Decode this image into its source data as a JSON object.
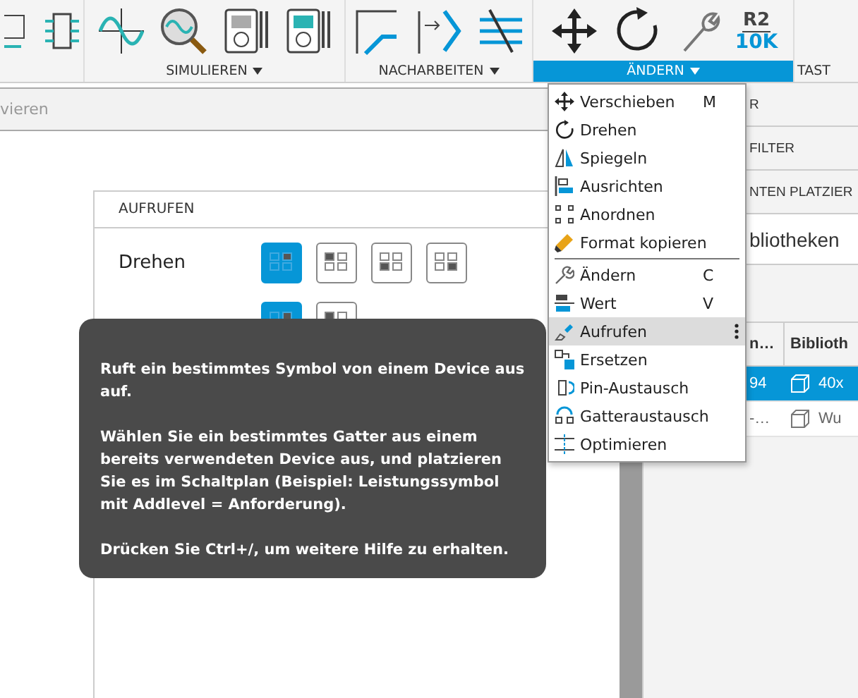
{
  "toolbar": {
    "groups": [
      {
        "label": "SIMULIEREN",
        "selected": false
      },
      {
        "label": "NACHARBEITEN",
        "selected": false
      },
      {
        "label": "ÄNDERN",
        "selected": true,
        "value_icon": {
          "top": "R2",
          "bottom": "10K"
        }
      },
      {
        "label": "TAST",
        "selected": false
      }
    ]
  },
  "search": {
    "placeholder": "vieren"
  },
  "command_panel": {
    "title": "AUFRUFEN",
    "rows": [
      {
        "label": "Drehen",
        "options": [
          {
            "selected": true
          },
          {
            "selected": false
          },
          {
            "selected": false
          },
          {
            "selected": false
          }
        ]
      },
      {
        "options": [
          {
            "selected": true
          },
          {
            "selected": false
          }
        ]
      }
    ]
  },
  "tooltip": {
    "paragraphs": [
      "Ruft ein bestimmtes Symbol von einem Device aus auf.",
      "Wählen Sie ein bestimmtes Gatter aus einem bereits verwendeten Device aus, und platzieren Sie es im Schaltplan (Beispiel: Leistungssymbol mit Addlevel = Anforderung).",
      "Drücken Sie Ctrl+/, um weitere Hilfe zu erhalten."
    ]
  },
  "menu": {
    "groups": [
      [
        {
          "label": "Verschieben",
          "shortcut": "M",
          "selected": false
        },
        {
          "label": "Drehen",
          "selected": false
        },
        {
          "label": "Spiegeln",
          "selected": false
        },
        {
          "label": "Ausrichten",
          "selected": false
        },
        {
          "label": "Anordnen",
          "selected": false
        },
        {
          "label": "Format kopieren",
          "selected": false
        }
      ],
      [
        {
          "label": "Ändern",
          "shortcut": "C",
          "selected": false
        },
        {
          "label": "Wert",
          "shortcut": "V",
          "selected": false
        },
        {
          "label": "Aufrufen",
          "selected": true
        },
        {
          "label": "Ersetzen",
          "selected": false
        },
        {
          "label": "Pin-Austausch",
          "selected": false
        },
        {
          "label": "Gatteraustausch",
          "selected": false
        },
        {
          "label": "Optimieren",
          "selected": false
        }
      ]
    ]
  },
  "right_panel": {
    "headers": [
      "R",
      "FILTER",
      "NTEN PLATZIER"
    ],
    "search": {
      "value": "bliotheken"
    },
    "table": {
      "columns": [
        "n…",
        "Biblioth"
      ],
      "rows": [
        {
          "cells": [
            "94",
            "40x"
          ],
          "selected": true
        },
        {
          "cells": [
            "-…",
            "Wu"
          ],
          "selected": false
        }
      ]
    }
  }
}
